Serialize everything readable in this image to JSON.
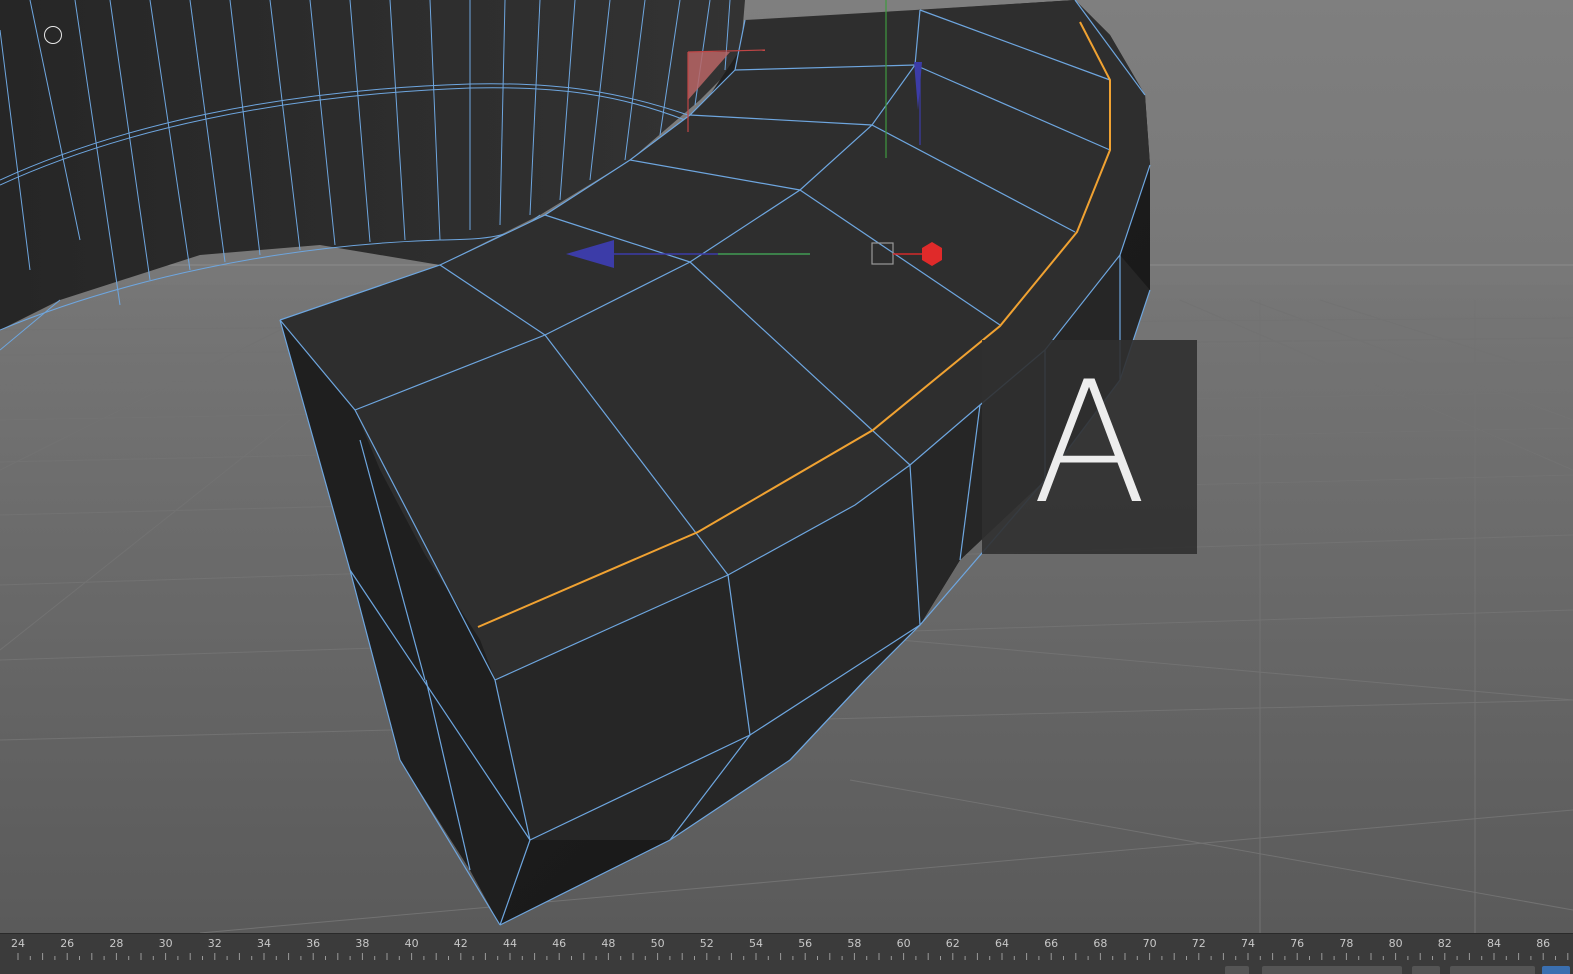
{
  "viewport": {
    "key_overlay_letter": "A",
    "colors": {
      "background_far": "#7b7b7b",
      "floor": "#626262",
      "grid_line": "#6e6e6e",
      "object_face": "#2c2c2c",
      "wireframe": "#6ea6df",
      "selected_edge": "#f0a232",
      "axis_x": "#d42a2a",
      "axis_y": "#3f9a3f",
      "axis_z": "#3c3ca8"
    },
    "icons": [
      "mode-circle-icon",
      "move-gizmo-icon",
      "axis-gizmo-icon"
    ]
  },
  "timeline": {
    "frame_labels": [
      "24",
      "26",
      "28",
      "30",
      "32",
      "34",
      "36",
      "38",
      "40",
      "42",
      "44",
      "46",
      "48",
      "50",
      "52",
      "54",
      "56",
      "58",
      "60",
      "62",
      "64",
      "66",
      "68",
      "70",
      "72",
      "74",
      "76",
      "78",
      "80",
      "82",
      "84",
      "86"
    ]
  }
}
